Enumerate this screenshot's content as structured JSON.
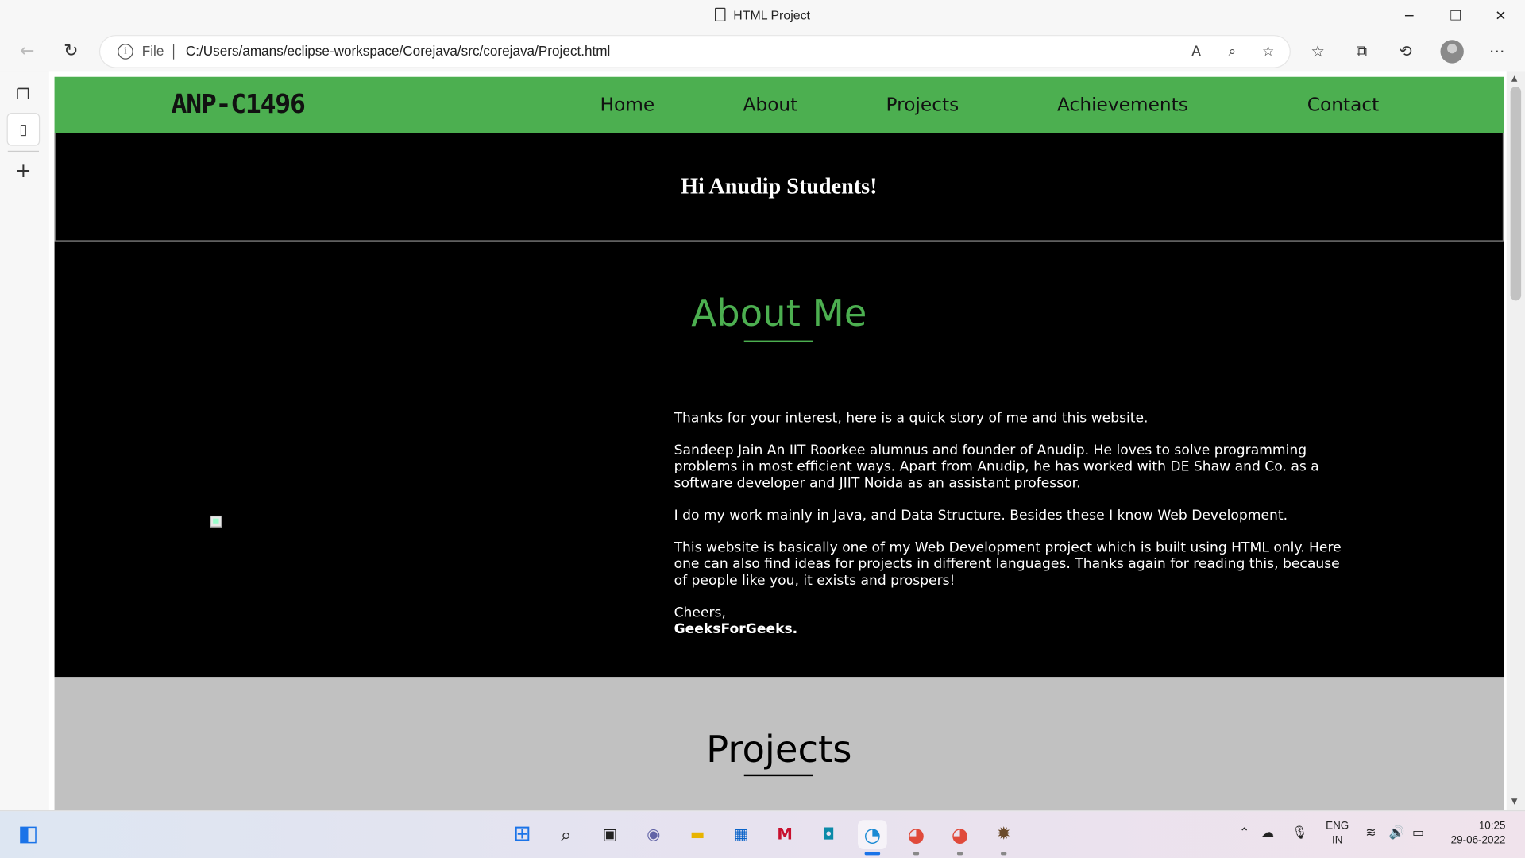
{
  "window": {
    "title": "HTML Project",
    "minimize_glyph": "─",
    "maximize_glyph": "❐",
    "close_glyph": "✕"
  },
  "toolbar": {
    "back_glyph": "←",
    "reload_glyph": "↻",
    "file_label": "File",
    "url": "C:/Users/amans/eclipse-workspace/Corejava/src/corejava/Project.html"
  },
  "site": {
    "logo": "ANP-C1496",
    "nav": [
      "Home",
      "About",
      "Projects",
      "Achievements",
      "Contact"
    ],
    "hero_text": "Hi Anudip Students!",
    "about": {
      "title": "About Me",
      "paragraphs": [
        "Thanks for your interest, here is a quick story of me and this website.",
        "Sandeep Jain An IIT Roorkee alumnus and founder of Anudip. He loves to solve programming problems in most efficient ways. Apart from Anudip, he has worked with DE Shaw and Co. as a software developer and JIIT Noida as an assistant professor.",
        "I do my work mainly in Java, and Data Structure. Besides these I know Web Development.",
        "This website is basically one of my Web Development project which is built using HTML only. Here one can also find ideas for projects in different languages. Thanks again for reading this, because of people like you, it exists and prospers!"
      ],
      "closing": "Cheers,",
      "signature": "GeeksForGeeks."
    },
    "projects_title": "Projects"
  },
  "taskbar": {
    "lang_top": "ENG",
    "lang_bottom": "IN",
    "time": "10:25",
    "date": "29-06-2022"
  },
  "colors": {
    "nav_green": "#4caf50",
    "about_title_green": "#4caf50",
    "projects_bg": "#c1c1c1"
  }
}
